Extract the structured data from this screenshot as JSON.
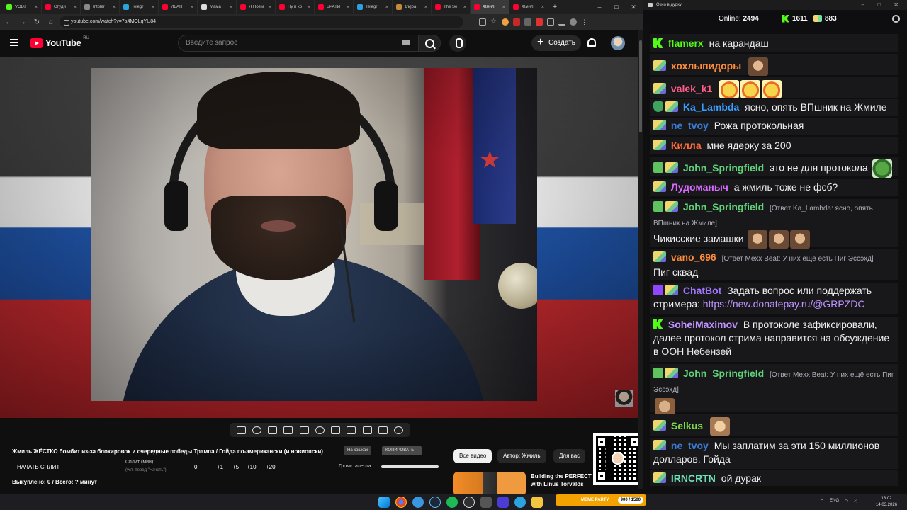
{
  "browser": {
    "tabs": [
      {
        "label": "VODs",
        "color": "#53fc18"
      },
      {
        "label": "Студи",
        "color": "#ff0033"
      },
      {
        "label": "Intoler",
        "color": "#8a8a8a"
      },
      {
        "label": "Telegr",
        "color": "#2aa3e0"
      },
      {
        "label": "ИВАН",
        "color": "#ff0033"
      },
      {
        "label": "Мама",
        "color": "#dddddd"
      },
      {
        "label": "Я Поем",
        "color": "#ff0033"
      },
      {
        "label": "Ну и ко",
        "color": "#ff0033"
      },
      {
        "label": "БРАТИ",
        "color": "#ff0033"
      },
      {
        "label": "Telegr",
        "color": "#2aa3e0"
      },
      {
        "label": "Дъ]ра",
        "color": "#c78a3a"
      },
      {
        "label": "The Se",
        "color": "#ff0033"
      },
      {
        "label": "Жмил",
        "color": "#ff0033",
        "active": true
      },
      {
        "label": "Жмил",
        "color": "#ff0033"
      }
    ],
    "url": "youtube.com/watch?v=7a4MOLqYU84"
  },
  "youtube": {
    "logo_text": "YouTube",
    "region": "RU",
    "search_placeholder": "Введите запрос",
    "create_label": "Создать"
  },
  "below": {
    "title": "Жмиль ЖЁСТКО бомбит из-за блокировок и очередные победы Трампа / Гойда по-американски (и новиопски)",
    "pill1": "На кошках",
    "pill2": "КОПИРОВАТЬ",
    "split_button": "НАЧАТЬ СПЛИТ",
    "split_label": "Сплит (мин):",
    "split_sub": "(уст. перед \"Начать\")",
    "split_values": [
      "0",
      "+1",
      "+5",
      "+10",
      "+20"
    ],
    "alert_label": "Громк. алерта:",
    "bought": "Выкуплено: 0 / Всего: ? минут",
    "chips": [
      "Все видео",
      "Автор: Жмиль",
      "Для вас"
    ],
    "rec_title": "Building the PERFECT with Linus Torvalds"
  },
  "chat_window": {
    "title": "Окно в дурку",
    "online_label": "Online:",
    "online_value": "2494",
    "kick_count": "1611",
    "vk_count": "883"
  },
  "colors": {
    "flamerx": "#53fc18",
    "hohl": "#ff8c3a",
    "valek": "#ff5c8a",
    "ka_lambda": "#3aa0ff",
    "ne_tvoy": "#3a7bd5",
    "killa": "#ff6b3a",
    "john": "#5fd37a",
    "ludo": "#d86bff",
    "vano": "#ff8c3a",
    "chatbot": "#a277ff",
    "sohei": "#bf94ff",
    "selkus": "#7fd84a",
    "irncrtn": "#6fe0b5"
  },
  "chat": [
    {
      "user": "flamerx",
      "text": "на карандаш"
    },
    {
      "user": "хохлыпидоры",
      "text": ""
    },
    {
      "user": "valek_k1",
      "text": ""
    },
    {
      "user": "Ka_Lambda",
      "text": "ясно, опять ВПшник на Жмиле"
    },
    {
      "user": "ne_tvoy",
      "text": "Рожа протокольная"
    },
    {
      "user": "Килла",
      "text": "мне ядерку за 200"
    },
    {
      "user": "John_Springfield",
      "text": "это не для протокола"
    },
    {
      "user": "Лудоманыч",
      "text": "а жмиль тоже не фсб?"
    },
    {
      "user": "John_Springfield",
      "reply": "[Ответ Ka_Lambda: ясно, опять ВПшник на Жмиле]",
      "text": "Чикисские замашки"
    },
    {
      "user": "vano_696",
      "reply": "[Ответ Mexx Beat: У них ещё есть Пиг Эссэхд]",
      "text": "Пиг сквад"
    },
    {
      "user": "ChatBot",
      "text": "Задать вопрос или поддержать стримера:",
      "link": "https://new.donatepay.ru/@GRPZDC"
    },
    {
      "user": "SoheiMaximov",
      "text": "В протоколе зафиксировали, далее протокол стрима направится на обсуждение в ООН Небензей"
    },
    {
      "user": "John_Springfield",
      "reply": "[Ответ Mexx Beat: У них ещё есть Пиг Эссэхд]",
      "text": ""
    },
    {
      "user": "Selkus",
      "text": ""
    },
    {
      "user": "ne_tvoy",
      "text": "Мы заплатим за эти 150 миллионов долларов. Гойда"
    },
    {
      "user": "IRNCRTN",
      "text": "ой дурак"
    }
  ],
  "taskbar": {
    "extension_label": "MEME PARTY",
    "extension_counter": "900 / 1500",
    "lang": "ENG",
    "time": "18:02",
    "date": "14.03.2026"
  }
}
